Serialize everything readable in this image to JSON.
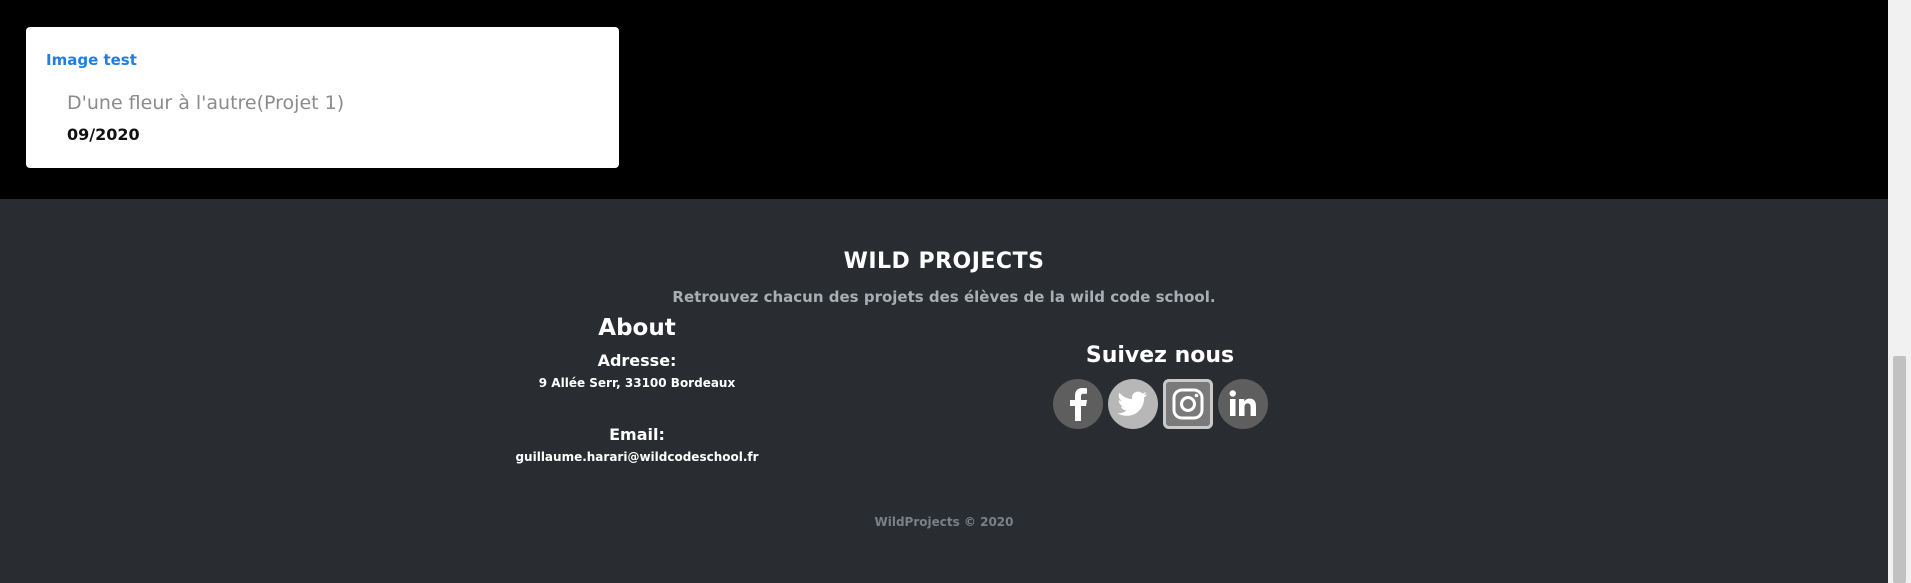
{
  "project_card": {
    "image_alt": "Image test",
    "title": "D'une fleur à l'autre(Projet 1)",
    "date": "09/2020"
  },
  "footer": {
    "title": "WILD PROJECTS",
    "tagline": "Retrouvez chacun des projets des élèves de la wild code school.",
    "about": {
      "heading": "About",
      "address_label": "Adresse:",
      "address_value": "9 Allée Serr, 33100 Bordeaux",
      "email_label": "Email:",
      "email_value": "guillaume.harari@wildcodeschool.fr"
    },
    "follow": {
      "heading": "Suivez nous",
      "icons": [
        "facebook-icon",
        "twitter-icon",
        "instagram-icon",
        "linkedin-icon"
      ]
    },
    "copyright": "WildProjects © 2020"
  },
  "colors": {
    "page_bg": "#000000",
    "footer_bg": "#292d31",
    "link_blue": "#1f7fe0",
    "icon_grey": "#5e5e5e"
  }
}
